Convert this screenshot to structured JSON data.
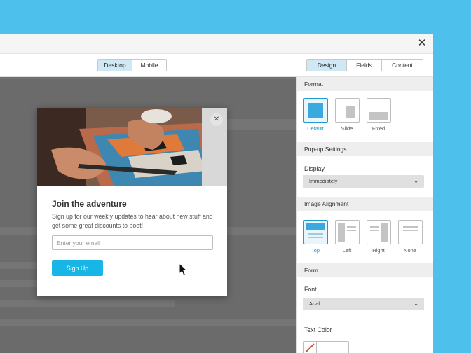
{
  "window": {
    "close_glyph": "✕"
  },
  "toolbar": {
    "view_tabs": [
      "Desktop",
      "Mobile"
    ],
    "panel_tabs": [
      "Design",
      "Fields",
      "Content"
    ]
  },
  "popup": {
    "close_glyph": "✕",
    "title": "Join the adventure",
    "description": "Sign up for our weekly updates to hear about new stuff and get some great discounts to boot!",
    "email_placeholder": "Enter your email",
    "button_label": "Sign Up"
  },
  "panel": {
    "format": {
      "heading": "Format",
      "options": [
        "Default",
        "Slide",
        "Fixed"
      ]
    },
    "popup_settings": {
      "heading": "Pop-up Settings",
      "display_label": "Display",
      "display_value": "Immediately"
    },
    "image_alignment": {
      "heading": "Image Alignment",
      "options": [
        "Top",
        "Left",
        "Right",
        "None"
      ]
    },
    "form": {
      "heading": "Form",
      "font_label": "Font",
      "font_value": "Arial",
      "text_color_label": "Text Color"
    }
  },
  "colors": {
    "background": "#4ec0ec",
    "accent": "#1f9bcf",
    "button": "#17b6e6",
    "overlay": "#6b6b6b"
  },
  "icons": [
    "close-icon",
    "chevron-down-icon",
    "mouse-pointer-icon",
    "no-color-icon"
  ]
}
